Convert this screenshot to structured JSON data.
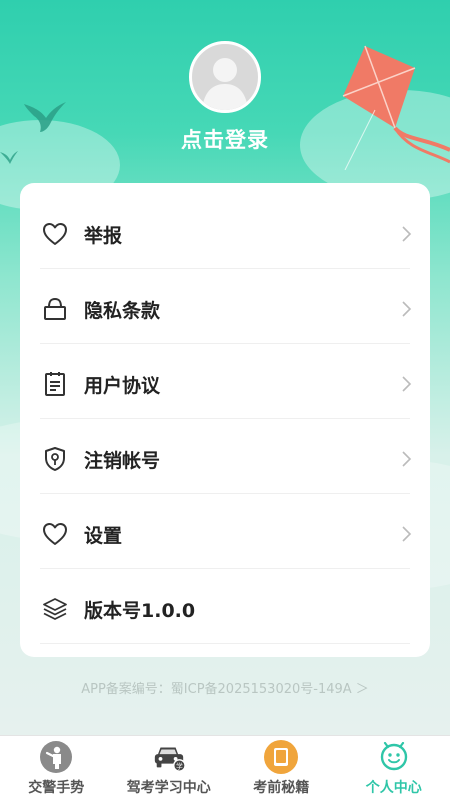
{
  "header": {
    "login_label": "点击登录"
  },
  "menu": [
    {
      "label": "举报",
      "icon": "heart-icon",
      "has_arrow": true
    },
    {
      "label": "隐私条款",
      "icon": "lock-icon",
      "has_arrow": true
    },
    {
      "label": "用户协议",
      "icon": "notepad-icon",
      "has_arrow": true
    },
    {
      "label": "注销帐号",
      "icon": "shield-key-icon",
      "has_arrow": true
    },
    {
      "label": "设置",
      "icon": "heart-icon",
      "has_arrow": true
    },
    {
      "label": "版本号1.0.0",
      "icon": "layers-icon",
      "has_arrow": false
    }
  ],
  "footer": {
    "icp": "APP备案编号：蜀ICP备2025153020号-149A ＞"
  },
  "tabs": [
    {
      "label": "交警手势",
      "icon": "traffic-police-icon",
      "active": false
    },
    {
      "label": "驾考学习中心",
      "icon": "car-study-icon",
      "active": false
    },
    {
      "label": "考前秘籍",
      "icon": "book-icon",
      "active": false
    },
    {
      "label": "个人中心",
      "icon": "smiley-face-icon",
      "active": true
    }
  ],
  "colors": {
    "accent": "#2fc6a8",
    "header_top": "#2fcfae",
    "kite": "#f07a66"
  }
}
